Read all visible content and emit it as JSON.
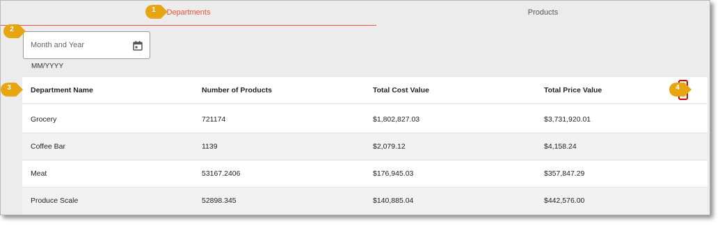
{
  "tabs": [
    {
      "label": "Departments",
      "active": true
    },
    {
      "label": "Products",
      "active": false
    }
  ],
  "date_filter": {
    "placeholder": "Month and Year",
    "helper_text": "MM/YYYY",
    "icon": "calendar-icon"
  },
  "table": {
    "columns": [
      "Department Name",
      "Number of Products",
      "Total Cost Value",
      "Total Price Value"
    ],
    "rows": [
      [
        "Grocery",
        "721174",
        "$1,802,827.03",
        "$3,731,920.01"
      ],
      [
        "Coffee Bar",
        "1139",
        "$2,079.12",
        "$4,158.24"
      ],
      [
        "Meat",
        "53167.2406",
        "$176,945.03",
        "$357,847.29"
      ],
      [
        "Produce Scale",
        "52898.345",
        "$140,885.04",
        "$442,576.00"
      ]
    ],
    "menu_icon": "more-vertical-icon"
  },
  "callouts": [
    "1",
    "2",
    "3",
    "4"
  ],
  "colors": {
    "accent": "#e8503a",
    "callout": "#e8a512",
    "highlight_border": "#d40000"
  }
}
